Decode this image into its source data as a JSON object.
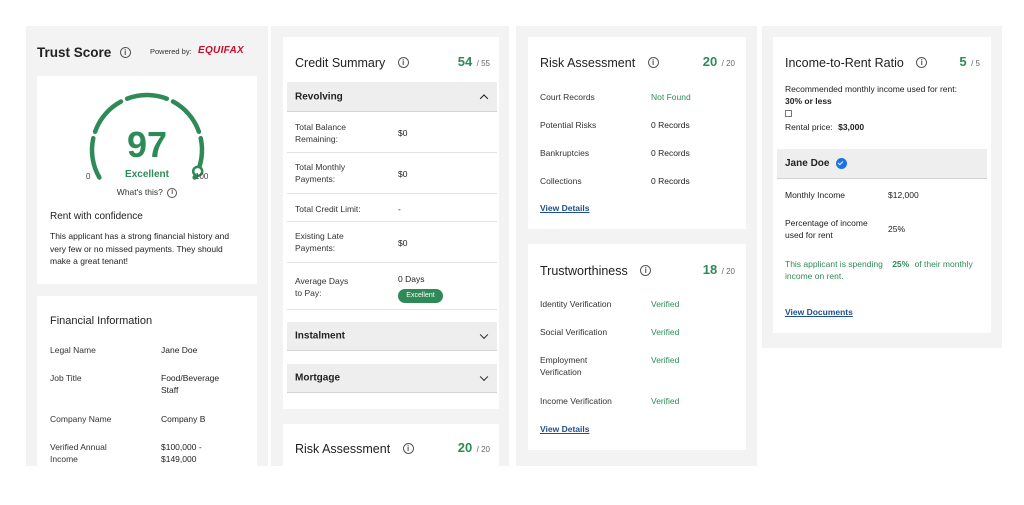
{
  "colors": {
    "accent_green": "#2e8b57",
    "link_blue": "#1f4e8c",
    "equifax_red": "#c8102e",
    "verified_badge": "#1a73e8"
  },
  "trust_score": {
    "title": "Trust Score",
    "powered_by": "Powered by:",
    "brand": "EQUIFAX",
    "score": "97",
    "rating": "Excellent",
    "min": "0",
    "max": "100",
    "score_fraction": 0.97,
    "whats_this": "What's this?",
    "confidence_title": "Rent with confidence",
    "confidence_text": "This applicant has a strong financial history and very few or no missed payments. They should make a great tenant!"
  },
  "financial_info": {
    "title": "Financial Information",
    "rows": [
      {
        "label": "Legal Name",
        "value": "Jane Doe"
      },
      {
        "label": "Job Title",
        "value": "Food/Beverage Staff"
      },
      {
        "label": "Company Name",
        "value": "Company B"
      },
      {
        "label": "Verified Annual Income",
        "value": "$100,000 - $149,000"
      }
    ]
  },
  "credit_summary": {
    "title": "Credit Summary",
    "score": "54",
    "score_den": "/ 55",
    "revolving": {
      "title": "Revolving",
      "rows": [
        {
          "label": "Total Balance Remaining:",
          "value": "$0"
        },
        {
          "label": "Total Monthly Payments:",
          "value": "$0"
        },
        {
          "label": "Total Credit Limit:",
          "value": "-"
        },
        {
          "label": "Existing Late Payments:",
          "value": "$0"
        },
        {
          "label": "Average Days to Pay:",
          "value": "0 Days",
          "badge": "Excellent"
        }
      ]
    },
    "instalment_title": "Instalment",
    "mortgage_title": "Mortgage"
  },
  "risk_assessment_partial": {
    "title": "Risk Assessment",
    "score": "20",
    "score_den": "/ 20"
  },
  "risk_assessment": {
    "title": "Risk Assessment",
    "score": "20",
    "score_den": "/ 20",
    "rows": [
      {
        "label": "Court Records",
        "value": "Not Found"
      },
      {
        "label": "Potential Risks",
        "value": "0 Records"
      },
      {
        "label": "Bankruptcies",
        "value": "0 Records"
      },
      {
        "label": "Collections",
        "value": "0 Records"
      }
    ],
    "link": "View Details"
  },
  "trustworthiness": {
    "title": "Trustworthiness",
    "score": "18",
    "score_den": "/ 20",
    "rows": [
      {
        "label": "Identity Verification",
        "value": "Verified"
      },
      {
        "label": "Social Verification",
        "value": "Verified"
      },
      {
        "label": "Employment Verification",
        "value": "Verified"
      },
      {
        "label": "Income Verification",
        "value": "Verified"
      }
    ],
    "link": "View Details"
  },
  "income_ratio": {
    "title": "Income-to-Rent Ratio",
    "score": "5",
    "score_den": "/ 5",
    "recommended_text": "Recommended monthly income used for rent:",
    "recommended_value": "30% or less",
    "rental_price_label": "Rental price:",
    "rental_price_value": "$3,000",
    "applicant_name": "Jane Doe",
    "monthly_income_label": "Monthly Income",
    "monthly_income_value": "$12,000",
    "pct_label": "Percentage of income used for rent",
    "pct_value": "25%",
    "spending_prefix": "This applicant is spending",
    "spending_value": "25%",
    "spending_suffix": "of their monthly income on rent.",
    "link": "View Documents"
  }
}
